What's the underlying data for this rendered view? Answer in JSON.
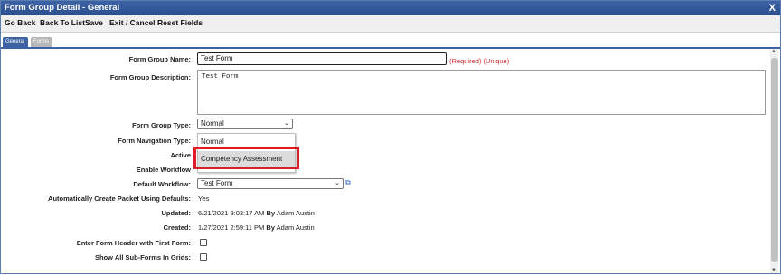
{
  "window": {
    "title": "Form Group Detail - General",
    "close": "X"
  },
  "toolbar": {
    "go_back": "Go Back",
    "back_to_list": "Back To List",
    "save": "Save",
    "exit_cancel": "Exit / Cancel",
    "reset_fields": "Reset Fields"
  },
  "tabs": [
    "General",
    "Forms"
  ],
  "form": {
    "name_label": "Form Group Name:",
    "name_value": "Test Form",
    "name_hint": "(Required) (Unique)",
    "desc_label": "Form Group Description:",
    "desc_value": "Test Form",
    "type_label": "Form Group Type:",
    "type_value": "Normal",
    "nav_label": "Form Navigation Type:",
    "active_label": "Active",
    "workflow_label": "Enable Workflow",
    "default_workflow_label": "Default Workflow:",
    "default_workflow_value": "Test Form",
    "auto_packet_label": "Automatically Create Packet Using Defaults:",
    "auto_packet_value": "Yes",
    "updated_label": "Updated:",
    "updated_value": "6/21/2021 9:03:17 AM",
    "updated_by": "By",
    "updated_user": "Adam Austin",
    "created_label": "Created:",
    "created_value": "1/27/2021 2:59:11 PM",
    "created_by": "By",
    "created_user": "Adam Austin",
    "header_first_label": "Enter Form Header with First Form:",
    "show_subforms_label": "Show All Sub-Forms In Grids:"
  },
  "dropdown": {
    "options": [
      "Normal",
      "Competency Assessment"
    ],
    "highlighted_index": 1
  },
  "icons": {
    "dropdown_chevron": "chevron-down-icon",
    "workflow_link": "external-link-icon"
  },
  "colors": {
    "accent": "#3e63a4",
    "required": "#d12b2b",
    "highlight_box": "#e01b24"
  }
}
